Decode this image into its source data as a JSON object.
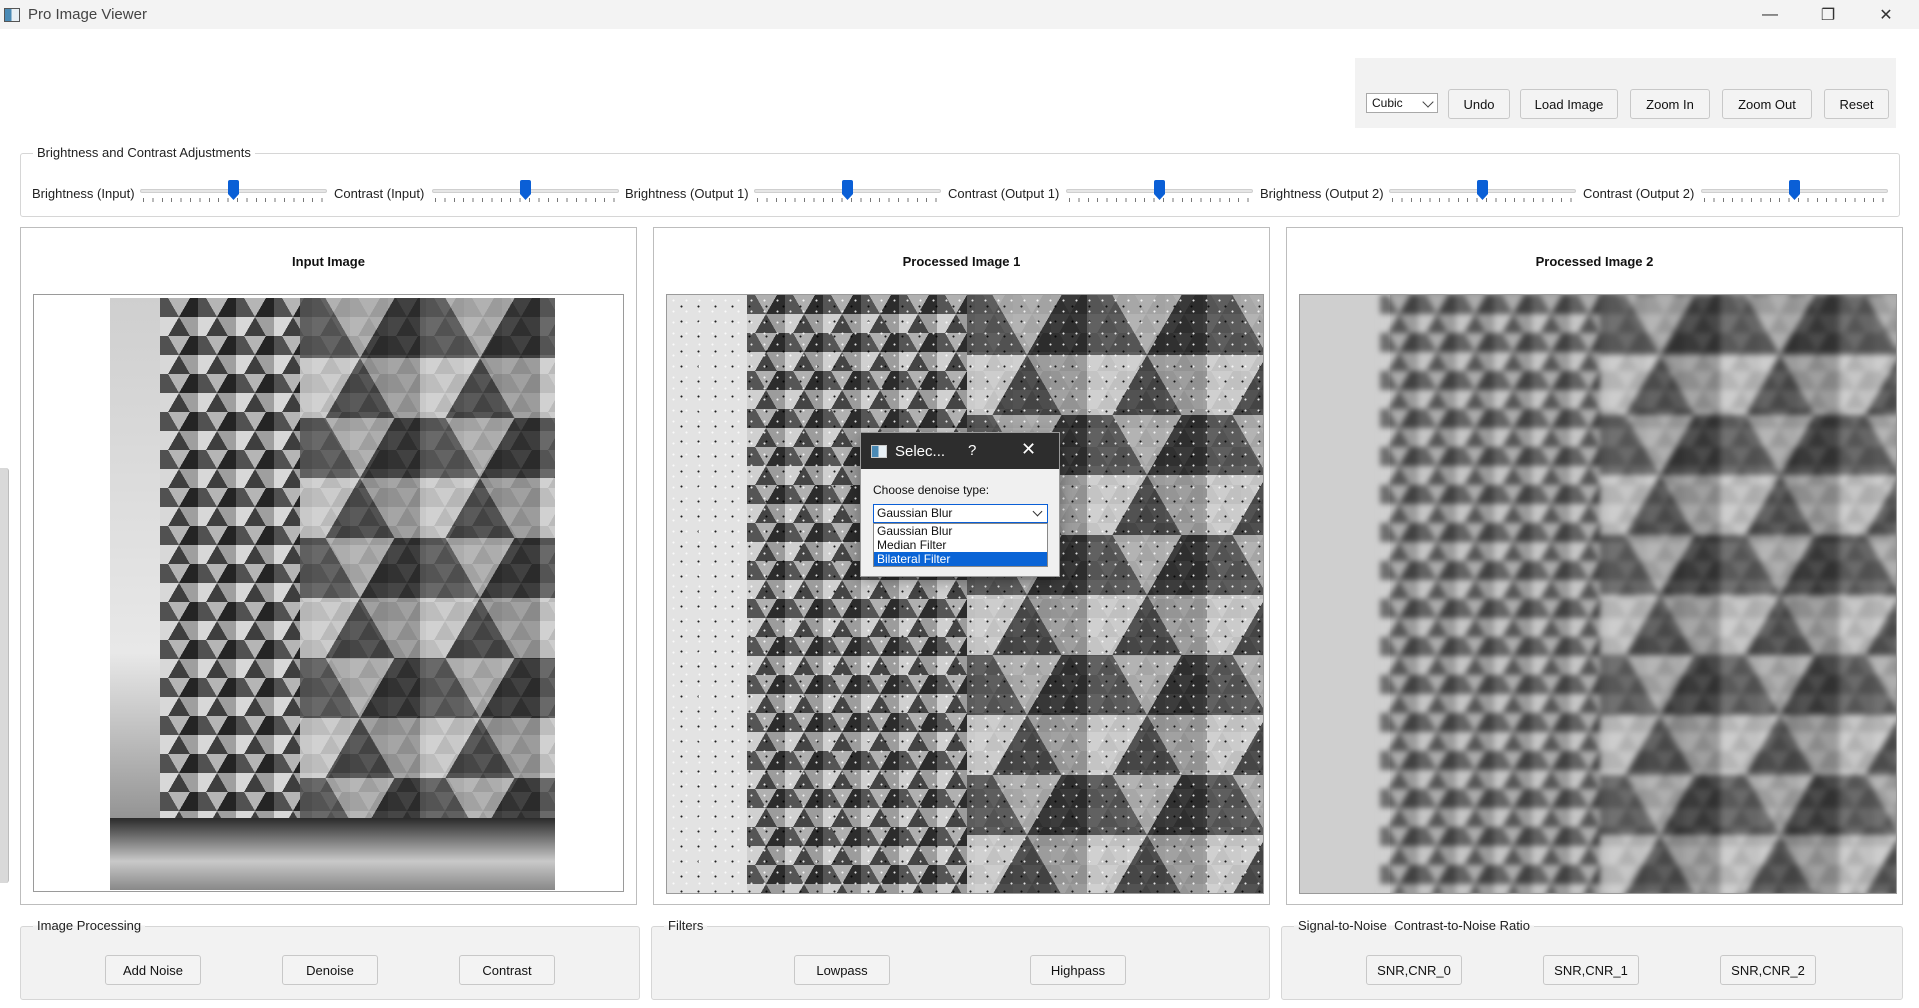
{
  "window": {
    "title": "Pro Image Viewer",
    "controls": [
      "—",
      "❐",
      "✕"
    ]
  },
  "toolbar": {
    "interpolation": "Cubic",
    "undo": "Undo",
    "load": "Load Image",
    "zoom_in": "Zoom In",
    "zoom_out": "Zoom Out",
    "reset": "Reset"
  },
  "adjustments": {
    "title": "Brightness and Contrast Adjustments",
    "sliders": [
      {
        "label": "Brightness (Input)",
        "value": 0.5
      },
      {
        "label": "Contrast (Input)",
        "value": 0.5
      },
      {
        "label": "Brightness (Output 1)",
        "value": 0.5
      },
      {
        "label": "Contrast (Output 1)",
        "value": 0.5
      },
      {
        "label": "Brightness (Output 2)",
        "value": 0.5
      },
      {
        "label": "Contrast (Output 2)",
        "value": 0.5
      }
    ]
  },
  "panels": {
    "input": "Input Image",
    "processed1": "Processed Image 1",
    "processed2": "Processed Image 2"
  },
  "dialog": {
    "title": "Selec...",
    "help": "?",
    "close": "✕",
    "label": "Choose denoise type:",
    "selected": "Gaussian Blur",
    "options": [
      "Gaussian Blur",
      "Median Filter",
      "Bilateral Filter"
    ],
    "highlighted": "Bilateral Filter"
  },
  "image_processing": {
    "title": "Image Processing",
    "add_noise": "Add Noise",
    "denoise": "Denoise",
    "contrast": "Contrast"
  },
  "filters": {
    "title": "Filters",
    "lowpass": "Lowpass",
    "highpass": "Highpass"
  },
  "snr": {
    "title": "Signal-to-Noise  Contrast-to-Noise Ratio",
    "b0": "SNR,CNR_0",
    "b1": "SNR,CNR_1",
    "b2": "SNR,CNR_2"
  }
}
